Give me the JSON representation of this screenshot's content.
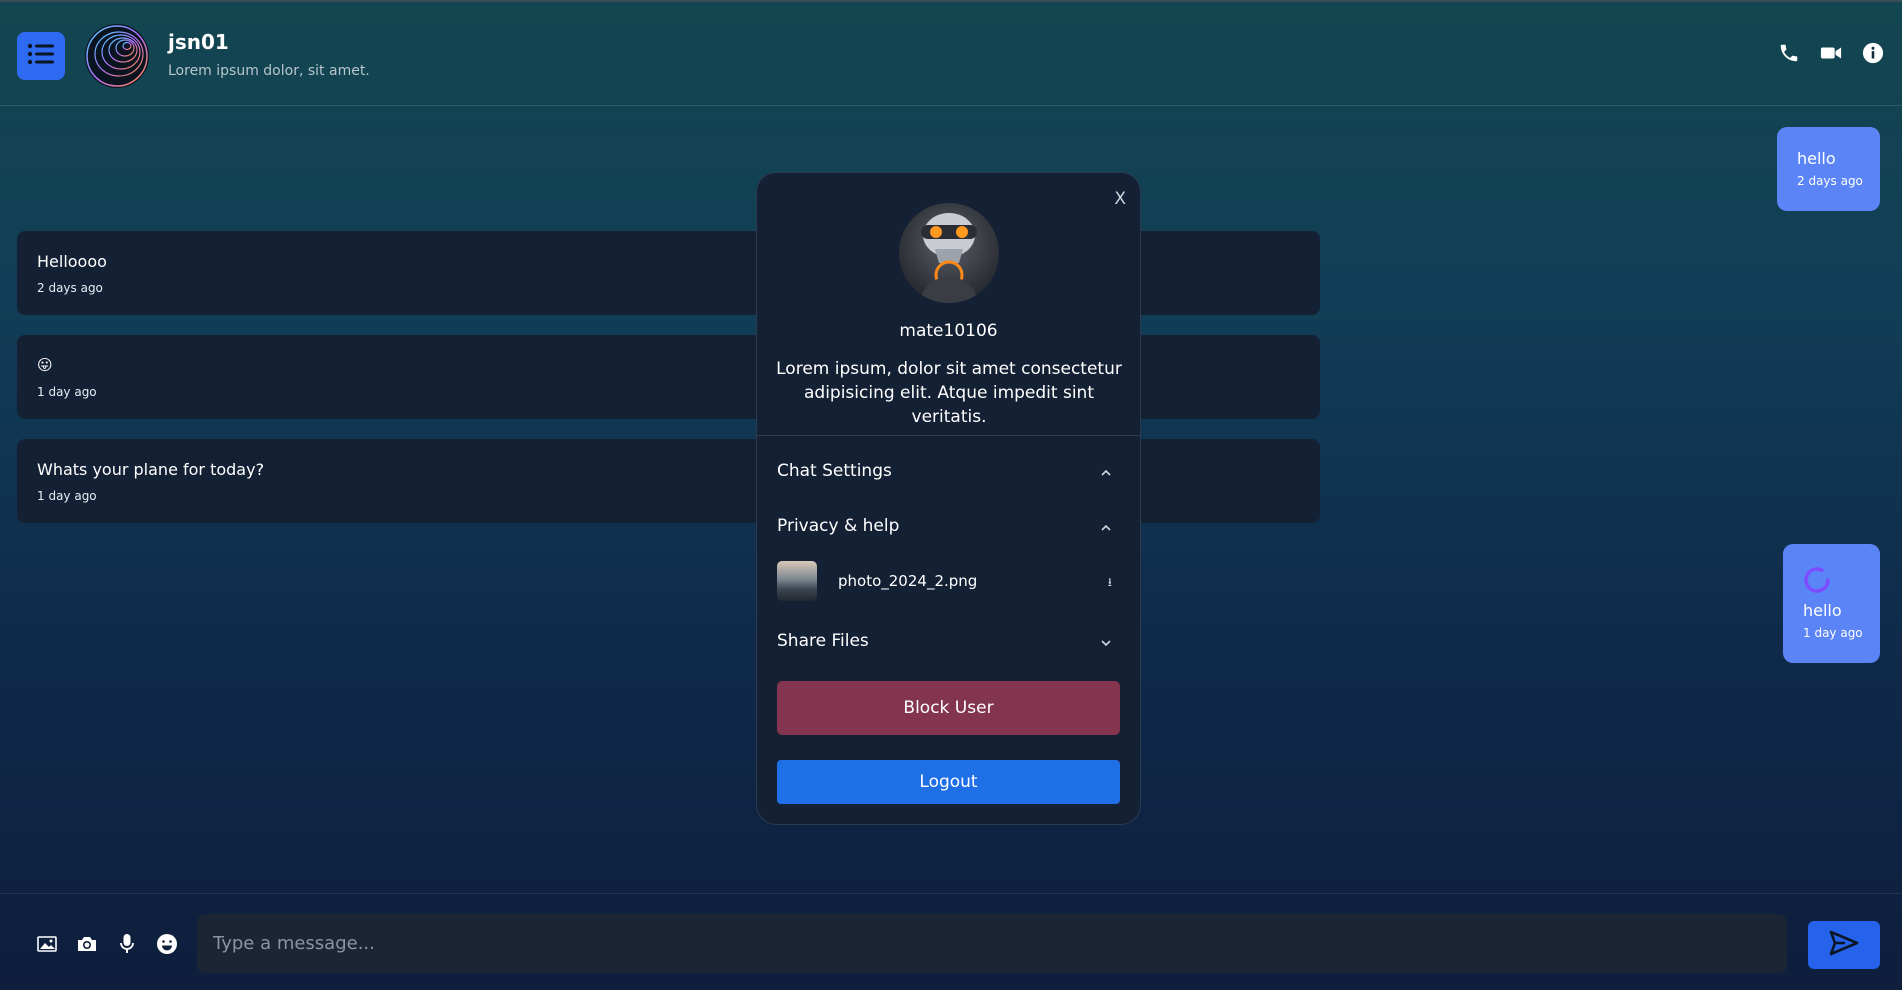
{
  "header": {
    "name": "jsn01",
    "status": "Lorem ipsum dolor, sit amet.",
    "icons": [
      "menu-list-icon",
      "phone-icon",
      "video-icon",
      "info-icon"
    ]
  },
  "messages": [
    {
      "side": "right",
      "text": "hello",
      "time": "2 days ago"
    },
    {
      "side": "left",
      "text": "Helloooo",
      "time": "2 days ago"
    },
    {
      "side": "left",
      "text": "😛",
      "time": "1 day ago"
    },
    {
      "side": "left",
      "text": "Whats your plane for today?",
      "time": "1 day ago"
    },
    {
      "side": "right",
      "text": "hello",
      "time": "1 day ago",
      "loading": true
    }
  ],
  "composer": {
    "placeholder": "Type a message...",
    "icons": [
      "image-icon",
      "camera-icon",
      "microphone-icon",
      "emoji-icon",
      "send-icon"
    ]
  },
  "modal": {
    "close_label": "X",
    "username": "mate10106",
    "description": "Lorem ipsum, dolor sit amet consectetur adipisicing elit. Atque impedit sint veritatis.",
    "sections": [
      {
        "label": "Chat Settings",
        "expanded": true
      },
      {
        "label": "Privacy & help",
        "expanded": true
      },
      {
        "label": "Share Files",
        "expanded": false
      }
    ],
    "file": {
      "name": "photo_2024_2.png",
      "download_glyph": "⭳"
    },
    "block_label": "Block User",
    "logout_label": "Logout"
  },
  "colors": {
    "accent": "#2f6bf2",
    "bubble_own": "#5b84f6",
    "bubble_other": "#142033",
    "block": "#833550",
    "logout": "#1f6fe6"
  }
}
